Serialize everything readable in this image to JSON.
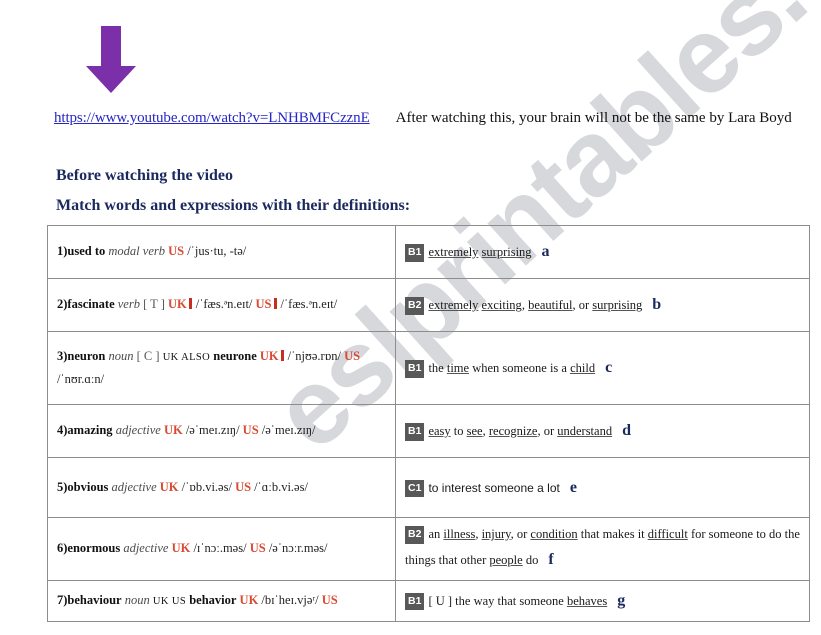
{
  "colors": {
    "arrow_purple": "#7b2fa8",
    "heading_navy": "#1b2a5e",
    "link_blue": "#2626c4",
    "region_red": "#d94a32",
    "badge_gray": "#585858",
    "watermark_gray": "#c9cbd0"
  },
  "watermark": {
    "text": "eslprintables.com"
  },
  "arrow": {
    "name": "down-arrow",
    "direction": "down",
    "color": "#7b2fa8"
  },
  "link_line": {
    "url": "https://www.youtube.com/watch?v=LNHBMFCzznE",
    "caption": "After watching this, your brain will not be the same  by Lara Boyd"
  },
  "headings": {
    "before_watching": "Before watching the video",
    "match_instruction": "Match words and expressions with their definitions:"
  },
  "table": {
    "rows": [
      {
        "number": "1)",
        "word": "used to",
        "pos": "modal verb",
        "grammar": "",
        "entries": [
          {
            "region": "US",
            "audio": false,
            "ipa": "/ˈjus·tu, -tə/"
          }
        ],
        "extra": "",
        "definition": {
          "level": "B1",
          "text": "extremely surprising",
          "letter": "a",
          "font": "serif",
          "underlined": [
            "extremely",
            "surprising"
          ]
        }
      },
      {
        "number": "2)",
        "word": "fascinate",
        "pos": "verb",
        "grammar": "[ T ]",
        "entries": [
          {
            "region": "UK",
            "audio": true,
            "ipa": "/ˈfæs.ᵊn.eɪt/"
          },
          {
            "region": "US",
            "audio": true,
            "ipa": "/ˈfæs.ᵊn.eɪt/"
          }
        ],
        "extra": "",
        "definition": {
          "level": "B2",
          "text": "extremely exciting, beautiful, or surprising",
          "letter": "b",
          "font": "serif",
          "underlined": [
            "extremely",
            "exciting",
            "beautiful",
            "surprising"
          ]
        }
      },
      {
        "number": "3)",
        "word": "neuron",
        "pos": "noun",
        "grammar": "[ C ]",
        "also_label": "UK ALSO",
        "also_word": "neurone",
        "entries": [
          {
            "region": "UK",
            "audio": true,
            "ipa": "/ˈnjʊə.rɒn/"
          },
          {
            "region": "US",
            "audio": false,
            "ipa": ""
          }
        ],
        "extra": "/ˈnʊr.ɑːn/",
        "definition": {
          "level": "B1",
          "text": "the time when someone is a child",
          "letter": "c",
          "font": "serif",
          "underlined": [
            "time",
            "child"
          ]
        }
      },
      {
        "number": "4)",
        "word": "amazing",
        "pos": "adjective",
        "grammar": "",
        "entries": [
          {
            "region": "UK",
            "audio": false,
            "ipa": "/əˈmeɪ.zɪŋ/"
          },
          {
            "region": "US",
            "audio": false,
            "ipa": "/əˈmeɪ.zɪŋ/"
          }
        ],
        "extra": "",
        "definition": {
          "level": "B1",
          "text": "easy to see, recognize, or understand",
          "letter": "d",
          "font": "serif",
          "underlined": [
            "easy",
            "see",
            "recognize",
            "understand"
          ]
        }
      },
      {
        "number": "5)",
        "word": "obvious",
        "pos": "adjective",
        "grammar": "",
        "entries": [
          {
            "region": "UK",
            "audio": false,
            "ipa": "/ˈɒb.vi.əs/"
          },
          {
            "region": "US",
            "audio": false,
            "ipa": "/ˈɑːb.vi.əs/"
          }
        ],
        "extra": "",
        "definition": {
          "level": "C1",
          "text": "to interest someone a lot",
          "letter": "e",
          "font": "sans",
          "underlined": []
        }
      },
      {
        "number": "6)",
        "word": "enormous",
        "pos": "adjective",
        "grammar": "",
        "entries": [
          {
            "region": "UK",
            "audio": false,
            "ipa": "/ɪˈnɔː.məs/"
          },
          {
            "region": "US",
            "audio": false,
            "ipa": "/əˈnɔːr.məs/"
          }
        ],
        "extra": "",
        "definition": {
          "level": "B2",
          "text": "an illness, injury, or condition that makes it difficult for someone to do the things that other people do",
          "letter": "f",
          "font": "serif",
          "underlined": [
            "illness",
            "injury",
            "condition",
            "difficult",
            "people"
          ]
        }
      },
      {
        "number": "7)",
        "word": "behaviour",
        "pos": "noun",
        "grammar": "",
        "also_label": "UK US",
        "also_word": "behavior",
        "entries": [
          {
            "region": "UK",
            "audio": false,
            "ipa": "/bɪˈheɪ.vjəʳ/"
          },
          {
            "region": "US",
            "audio": false,
            "ipa": ""
          }
        ],
        "extra": "",
        "definition": {
          "level": "B1",
          "prefix": "[ U ]",
          "text": "the way that someone behaves",
          "letter": "g",
          "font": "serif",
          "underlined": [
            "behaves"
          ]
        }
      }
    ]
  }
}
